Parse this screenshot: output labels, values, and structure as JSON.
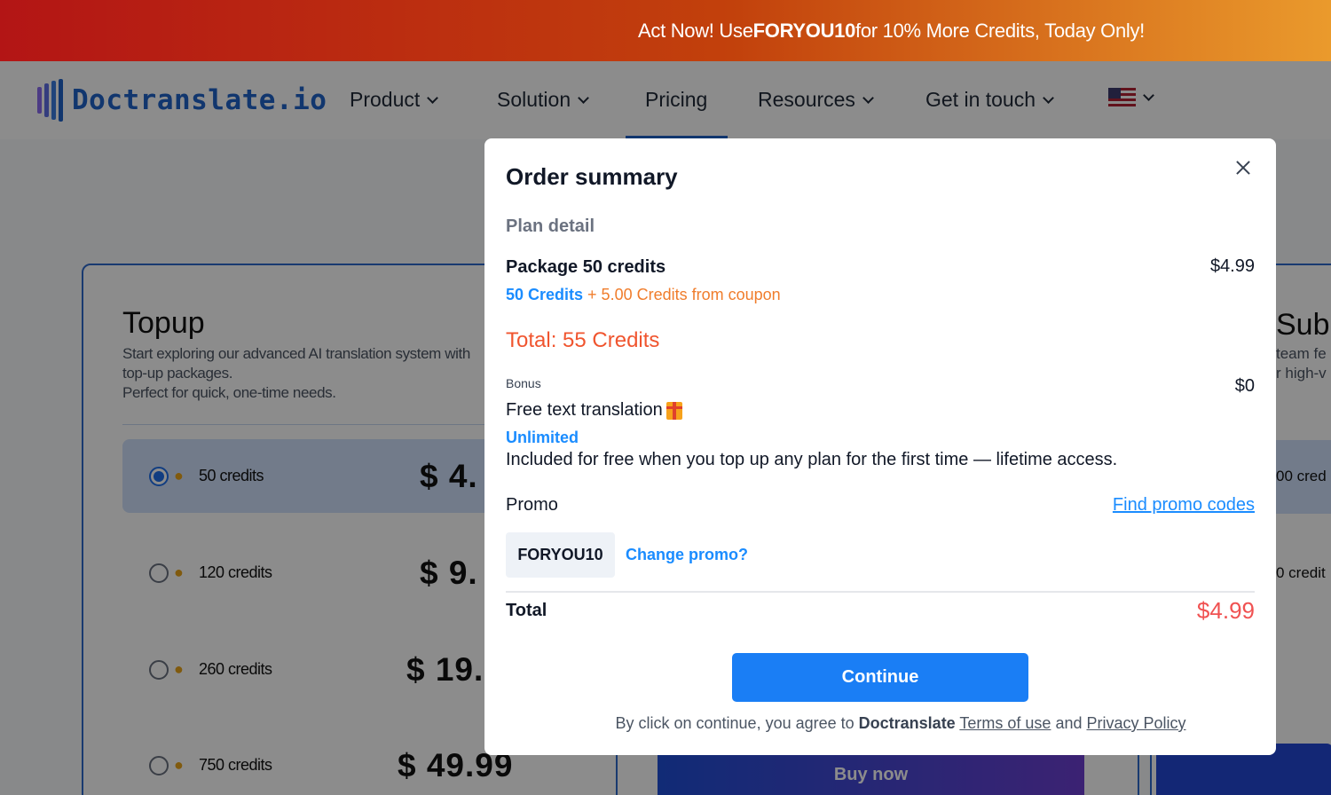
{
  "banner": {
    "prefix": "Act Now! Use ",
    "code": "FORYOU10",
    "suffix": " for 10% More Credits, Today Only!"
  },
  "header": {
    "logo_text": "Doctranslate.io",
    "nav": [
      {
        "label": "Product"
      },
      {
        "label": "Solution"
      },
      {
        "label": "Pricing"
      },
      {
        "label": "Resources"
      },
      {
        "label": "Get in touch"
      }
    ],
    "language_icon": "us-flag-icon"
  },
  "topup": {
    "title": "Topup",
    "description_line1": "Start exploring our advanced AI translation system with",
    "description_line2": "top-up packages.",
    "description_line3": "Perfect for quick, one-time needs.",
    "options": [
      {
        "label": "50 credits",
        "price": "$ 4.",
        "selected": true
      },
      {
        "label": "120 credits",
        "price": "$ 9.",
        "selected": false
      },
      {
        "label": "260 credits",
        "price": "$ 19.",
        "selected": false
      },
      {
        "label": "750 credits",
        "price": "$ 49.99",
        "selected": false
      }
    ]
  },
  "subscription": {
    "title": "Sub",
    "desc_line1": "team fe",
    "desc_line2": "r high-v",
    "option1": "00 cred",
    "option2": "0 credit"
  },
  "buy_now": "Buy now",
  "modal": {
    "title": "Order summary",
    "plan_detail": "Plan detail",
    "package_name": "Package 50 credits",
    "package_price": "$4.99",
    "credits_base": "50 Credits",
    "credits_plus": " + 5.00 Credits from coupon",
    "total_credits": "Total: 55 Credits",
    "bonus_label": "Bonus",
    "bonus_price": "$0",
    "bonus_name": "Free text translation",
    "bonus_tag": "Unlimited",
    "bonus_desc": "Included for free when you top up any plan for the first time — lifetime access.",
    "promo_label": "Promo",
    "promo_find": "Find promo codes",
    "promo_code": "FORYOU10",
    "promo_change": "Change promo?",
    "total_label": "Total",
    "total_price": "$4.99",
    "continue_label": "Continue",
    "agree_prefix": "By click on continue, you agree to ",
    "agree_brand": "Doctranslate",
    "agree_terms": "Terms of use",
    "agree_and": " and ",
    "agree_privacy": "Privacy Policy"
  },
  "colors": {
    "brand_blue": "#1f63c8",
    "accent_blue": "#1a7ef5",
    "price_red": "#f05252",
    "credits_orange": "#f07d2c"
  }
}
